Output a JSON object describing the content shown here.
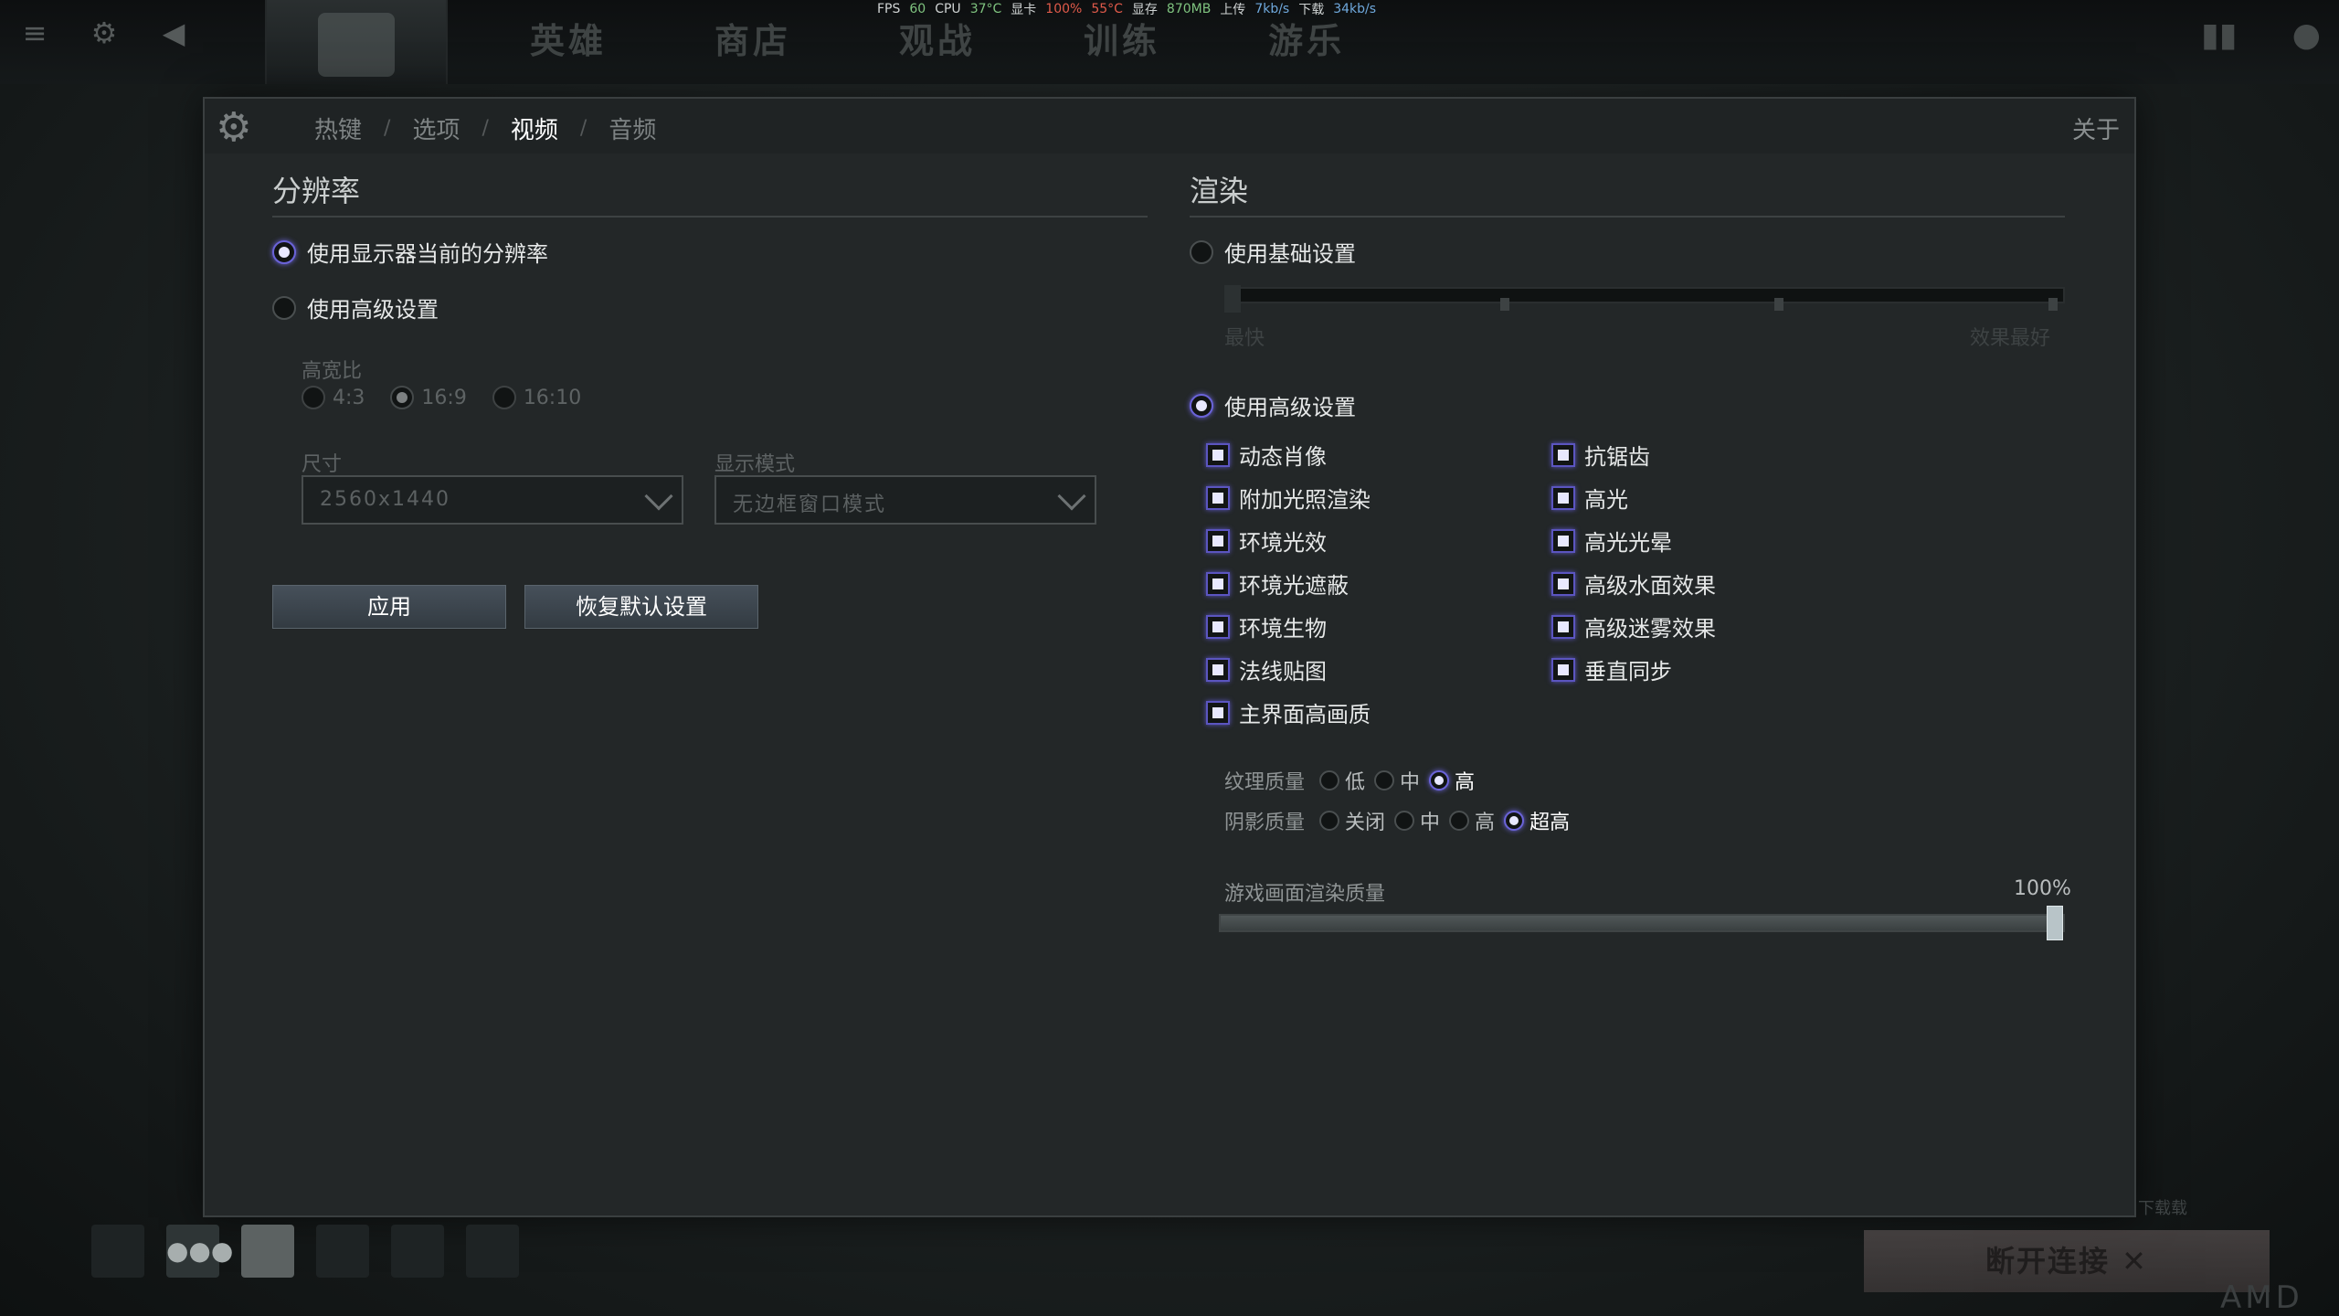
{
  "hud": {
    "fps_label": "FPS",
    "fps": "60",
    "cpu_label": "CPU",
    "cpu_temp": "37°C",
    "gpu_label": "显卡",
    "gpu_load": "100%",
    "gpu_temp": "55°C",
    "vram_label": "显存",
    "vram": "870MB",
    "up_label": "上传",
    "up": "7kb/s",
    "down_label": "下载",
    "down": "34kb/s"
  },
  "main_nav": [
    "英雄",
    "商店",
    "观战",
    "训练",
    "游乐"
  ],
  "settings": {
    "tabs": [
      {
        "label": "热键",
        "active": false
      },
      {
        "label": "选项",
        "active": false
      },
      {
        "label": "视频",
        "active": true
      },
      {
        "label": "音频",
        "active": false
      }
    ],
    "tab_separator": "/",
    "about": "关于",
    "resolution": {
      "title": "分辨率",
      "use_current": "使用显示器当前的分辨率",
      "use_advanced": "使用高级设置",
      "aspect_label": "高宽比",
      "aspect_options": [
        "4:3",
        "16:9",
        "16:10"
      ],
      "aspect_selected": "16:9",
      "size_label": "尺寸",
      "size_value": "2560x1440",
      "mode_label": "显示模式",
      "mode_value": "无边框窗口模式",
      "apply": "应用",
      "reset": "恢复默认设置"
    },
    "render": {
      "title": "渲染",
      "use_basic": "使用基础设置",
      "basic_min": "最快",
      "basic_max": "效果最好",
      "use_advanced": "使用高级设置",
      "left_checks": [
        "动态肖像",
        "附加光照渲染",
        "环境光效",
        "环境光遮蔽",
        "环境生物",
        "法线贴图",
        "主界面高画质"
      ],
      "right_checks": [
        "抗锯齿",
        "高光",
        "高光光晕",
        "高级水面效果",
        "高级迷雾效果",
        "垂直同步"
      ],
      "texture_label": "纹理质量",
      "texture_options": [
        "低",
        "中",
        "高"
      ],
      "texture_selected": "高",
      "shadow_label": "阴影质量",
      "shadow_options": [
        "关闭",
        "中",
        "高",
        "超高"
      ],
      "shadow_selected": "超高",
      "quality_label": "游戏画面渲染质量",
      "quality_value": "100%",
      "quality_fraction": 1.0
    }
  },
  "bottom": {
    "disconnect": "断开连接 ✕",
    "hint": "下载载",
    "brand": "AMD"
  },
  "colors": {
    "accent": "#6a63d8",
    "panel_bg": "#232728"
  }
}
